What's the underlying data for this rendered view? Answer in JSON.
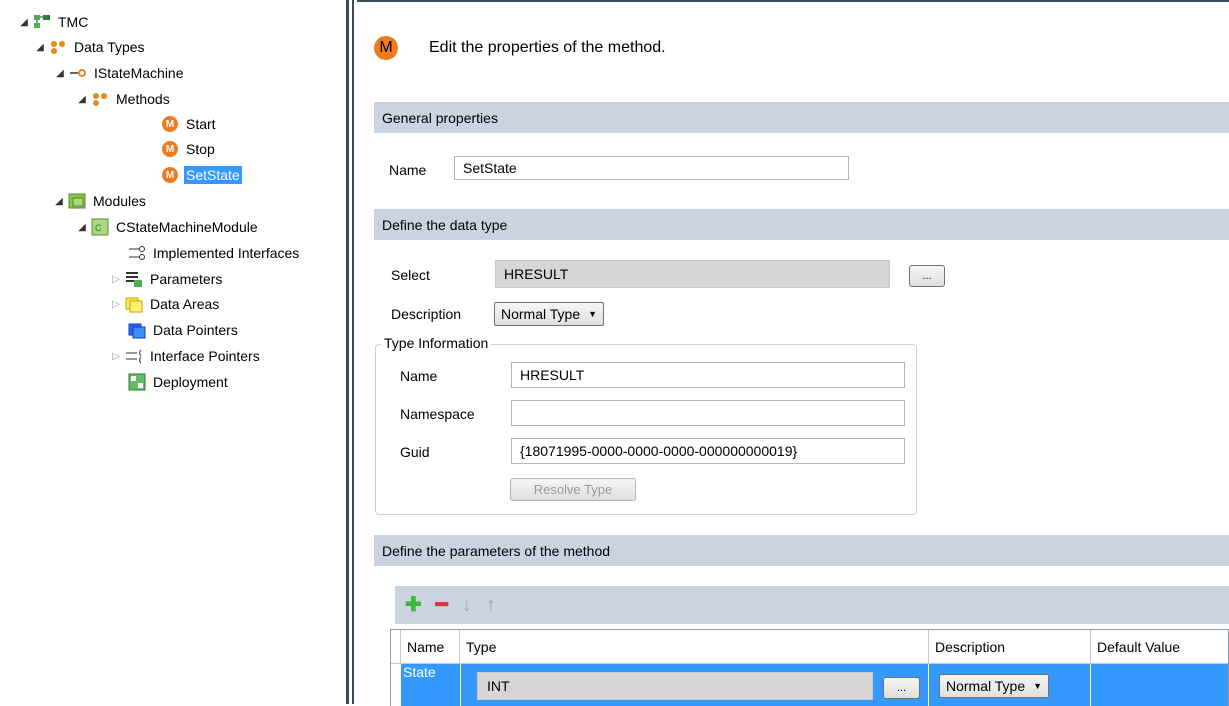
{
  "tree": {
    "root": "TMC",
    "data_types": "Data Types",
    "interface": "IStateMachine",
    "methods": "Methods",
    "method_start": "Start",
    "method_stop": "Stop",
    "method_setstate": "SetState",
    "modules": "Modules",
    "module": "CStateMachineModule",
    "implemented_interfaces": "Implemented Interfaces",
    "parameters": "Parameters",
    "data_areas": "Data Areas",
    "data_pointers": "Data Pointers",
    "interface_pointers": "Interface Pointers",
    "deployment": "Deployment",
    "method_icon_letter": "M"
  },
  "header": {
    "icon_letter": "M",
    "title": "Edit the properties of the method."
  },
  "general": {
    "section": "General properties",
    "name_label": "Name",
    "name_value": "SetState"
  },
  "datatype": {
    "section": "Define the data type",
    "select_label": "Select",
    "select_value": "HRESULT",
    "browse": "...",
    "description_label": "Description",
    "description_value": "Normal Type",
    "typeinfo_title": "Type Information",
    "ti_name_label": "Name",
    "ti_name_value": "HRESULT",
    "ti_namespace_label": "Namespace",
    "ti_namespace_value": "",
    "ti_guid_label": "Guid",
    "ti_guid_value": "{18071995-0000-0000-0000-000000000019}",
    "resolve_button": "Resolve Type"
  },
  "params": {
    "section": "Define the parameters of the method",
    "columns": [
      "Name",
      "Type",
      "Description",
      "Default Value"
    ],
    "rows": [
      {
        "name": "State",
        "type": "INT",
        "browse": "...",
        "description": "Normal Type"
      }
    ]
  },
  "colors": {
    "accent_blue": "#3399ff",
    "section_bg": "#c9d4e0",
    "method_orange": "#f07a1e",
    "add_green": "#3fb63f",
    "remove_red": "#e0303a"
  }
}
